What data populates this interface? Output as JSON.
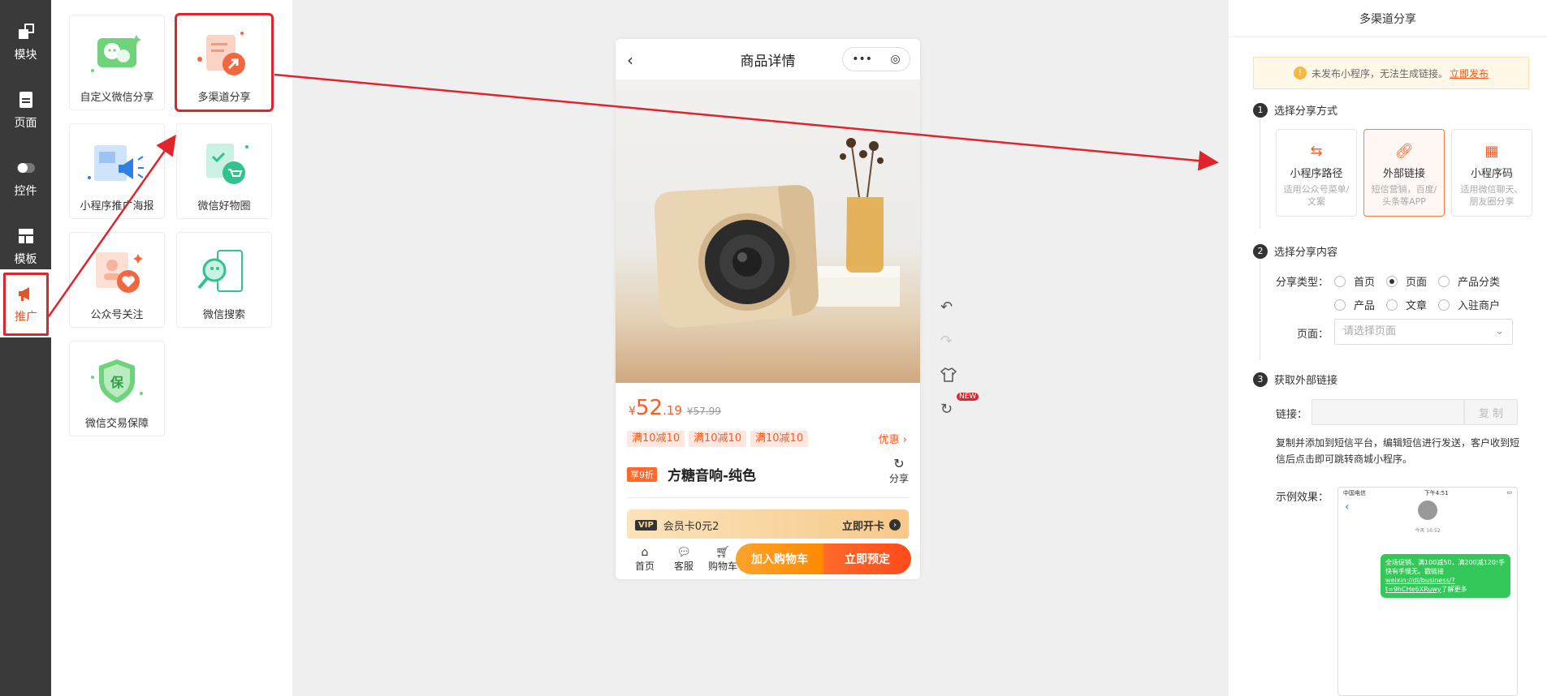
{
  "rail": {
    "items": [
      {
        "label": "模块",
        "icon": "module-icon"
      },
      {
        "label": "页面",
        "icon": "page-icon"
      },
      {
        "label": "控件",
        "icon": "toggle-icon"
      },
      {
        "label": "模板",
        "icon": "template-icon"
      },
      {
        "label": "推广",
        "icon": "megaphone-icon"
      }
    ]
  },
  "widgets": [
    {
      "label": "自定义微信分享"
    },
    {
      "label": "多渠道分享"
    },
    {
      "label": "小程序推广海报"
    },
    {
      "label": "微信好物圈"
    },
    {
      "label": "公众号关注"
    },
    {
      "label": "微信搜索"
    },
    {
      "label": "微信交易保障"
    }
  ],
  "phone": {
    "title": "商品详情",
    "capsule_dots": "•••",
    "price_currency": "¥",
    "price_int": "52",
    "price_dec": ".19",
    "price_old": "¥57.99",
    "coupons": [
      "满10减10",
      "满10减10",
      "满10减10"
    ],
    "promo": "优惠 ›",
    "discount_tag": "享9折",
    "product_name": "方糖音响-纯色",
    "share_label": "分享",
    "vip_tag": "VIP",
    "vip_text": "会员卡0元2",
    "vip_action": "立即开卡",
    "tabs": [
      "首页",
      "客服",
      "购物车"
    ],
    "add_cart": "加入购物车",
    "buy_now": "立即预定"
  },
  "tools": {
    "new_badge": "NEW"
  },
  "settings": {
    "title": "多渠道分享",
    "notice_text": "未发布小程序，无法生成链接。",
    "notice_link": "立即发布",
    "step1": {
      "num": "1",
      "label": "选择分享方式"
    },
    "options": [
      {
        "title": "小程序路径",
        "desc": "适用公众号菜单/文案"
      },
      {
        "title": "外部链接",
        "desc": "短信营销，百度/头条等APP"
      },
      {
        "title": "小程序码",
        "desc": "适用微信聊天、朋友圈分享"
      }
    ],
    "step2": {
      "num": "2",
      "label": "选择分享内容"
    },
    "share_type_label": "分享类型：",
    "radios": [
      "首页",
      "页面",
      "产品分类",
      "产品",
      "文章",
      "入驻商户"
    ],
    "page_label": "页面：",
    "page_placeholder": "请选择页面",
    "step3": {
      "num": "3",
      "label": "获取外部链接"
    },
    "link_label": "链接：",
    "copy_btn": "复 制",
    "desc": "复制并添加到短信平台，编辑短信进行发送，客户收到短信后点击即可跳转商城小程序。",
    "demo_label": "示例效果：",
    "demo": {
      "carrier": "中国电信",
      "time": "下午4:51",
      "info_time": "今天 16:52",
      "bubble": "全场促销，满100减50，满200减120!手快有手慢无。戳链接",
      "bubble_link": "weixin://dl/business/?t=9hCHe6XRuwy",
      "bubble_tail": "了解更多"
    }
  }
}
